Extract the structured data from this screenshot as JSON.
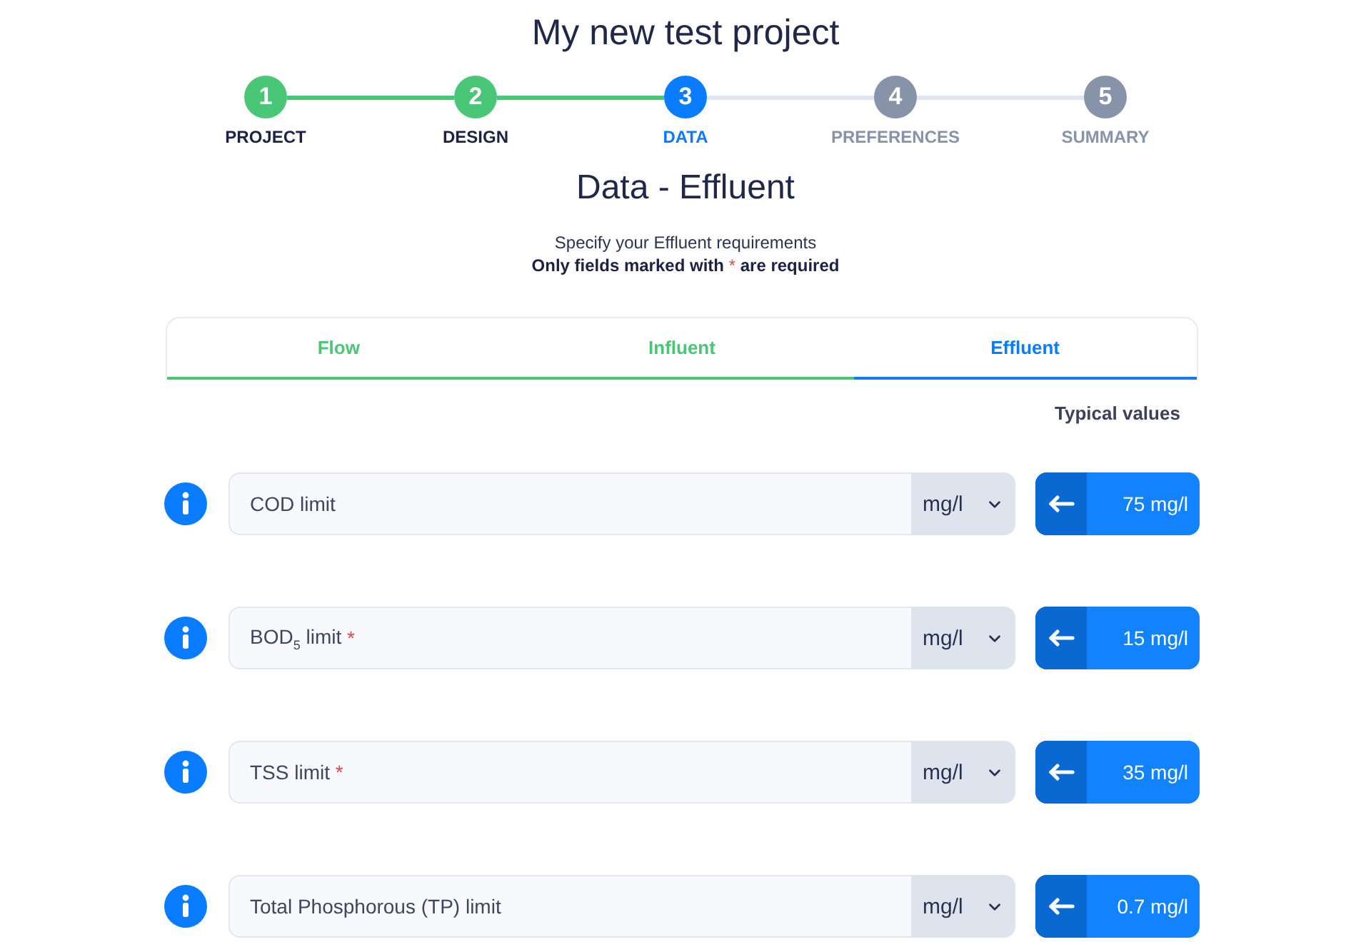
{
  "title": "My new test project",
  "steps": [
    {
      "number": "1",
      "label": "PROJECT",
      "completed": true,
      "selected": false
    },
    {
      "number": "2",
      "label": "DESIGN",
      "completed": true,
      "selected": false
    },
    {
      "number": "3",
      "label": "DATA",
      "completed": false,
      "selected": true
    },
    {
      "number": "4",
      "label": "PREFERENCES",
      "completed": false,
      "selected": false
    },
    {
      "number": "5",
      "label": "SUMMARY",
      "completed": false,
      "selected": false
    }
  ],
  "heading": "Data - Effluent",
  "intro": {
    "text": "Specify your Effluent requirements",
    "note_before": "Only fields marked with",
    "note_mark": "*",
    "note_after": "are required"
  },
  "tabs": [
    {
      "label": "Flow",
      "selected": false,
      "completed": true
    },
    {
      "label": "Influent",
      "selected": false,
      "completed": true
    },
    {
      "label": "Effluent",
      "selected": true,
      "completed": false
    }
  ],
  "typical_header": "Typical values",
  "fields": [
    {
      "placeholder": "COD limit",
      "unit": "mg/l",
      "typical": "75 mg/l"
    },
    {
      "placeholder": "BOD$_{5}$ limit",
      "required_mark": "*",
      "unit": "mg/l",
      "typical": "15 mg/l"
    },
    {
      "placeholder": "TSS limit",
      "required_mark": "*",
      "unit": "mg/l",
      "typical": "35 mg/l"
    },
    {
      "placeholder": "Total Phosphorous (TP) limit",
      "unit": "mg/l",
      "typical": "0.7 mg/l"
    }
  ]
}
